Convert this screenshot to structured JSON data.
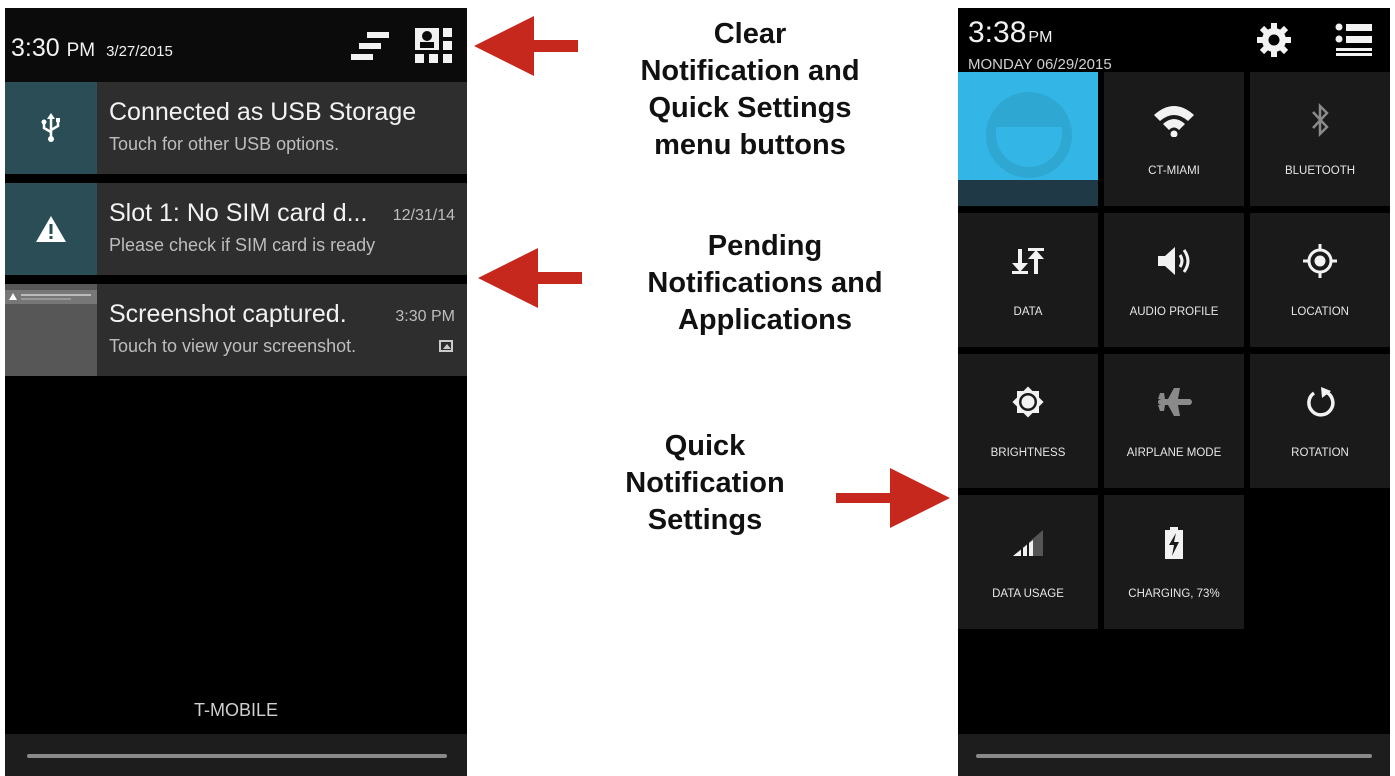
{
  "left_screen": {
    "status_bar": {
      "time": "3:30",
      "ampm": "PM",
      "date": "3/27/2015",
      "clear_icon": "clear-notifications-icon",
      "quick_settings_icon": "quick-settings-icon"
    },
    "notifications": [
      {
        "icon": "usb-icon",
        "title": "Connected as USB Storage",
        "subtitle": "Touch for other USB options.",
        "time": ""
      },
      {
        "icon": "warning-icon",
        "title": "Slot 1: No SIM card d...",
        "subtitle": "Please check if SIM card is ready",
        "time": "12/31/14"
      },
      {
        "icon": "screenshot-thumbnail",
        "title": "Screenshot captured.",
        "subtitle": "Touch to view your screenshot.",
        "time": "3:30 PM"
      }
    ],
    "carrier": "T-MOBILE"
  },
  "annotations": {
    "top": [
      "Clear",
      "Notification and",
      "Quick Settings",
      "menu buttons"
    ],
    "middle": [
      "Pending",
      "Notifications and",
      "Applications"
    ],
    "bottom": [
      "Quick",
      "Notification",
      "Settings"
    ]
  },
  "right_screen": {
    "status_bar": {
      "time": "3:38",
      "ampm": "PM",
      "date": "MONDAY 06/29/2015",
      "settings_icon": "gear-icon",
      "notifications_icon": "list-icon"
    },
    "tiles": [
      {
        "id": "user",
        "label": "",
        "icon": "user-avatar"
      },
      {
        "id": "wifi",
        "label": "CT-MIAMI",
        "icon": "wifi-icon"
      },
      {
        "id": "bluetooth",
        "label": "BLUETOOTH",
        "icon": "bluetooth-icon"
      },
      {
        "id": "data",
        "label": "DATA",
        "icon": "data-arrows-icon"
      },
      {
        "id": "audio",
        "label": "AUDIO PROFILE",
        "icon": "speaker-icon"
      },
      {
        "id": "location",
        "label": "LOCATION",
        "icon": "location-icon"
      },
      {
        "id": "brightness",
        "label": "BRIGHTNESS",
        "icon": "brightness-icon"
      },
      {
        "id": "airplane",
        "label": "AIRPLANE MODE",
        "icon": "airplane-icon"
      },
      {
        "id": "rotation",
        "label": "ROTATION",
        "icon": "rotation-icon"
      },
      {
        "id": "data_usage",
        "label": "DATA USAGE",
        "icon": "signal-icon"
      },
      {
        "id": "battery",
        "label": "CHARGING, 73%",
        "icon": "battery-charging-icon"
      }
    ]
  },
  "colors": {
    "arrow": "#c6281d",
    "notification_icon_bg": "#2b4e56",
    "notification_bg": "#2e2e2e",
    "tile_bg": "#1a1a1a",
    "user_tile": "#33b5e5"
  }
}
